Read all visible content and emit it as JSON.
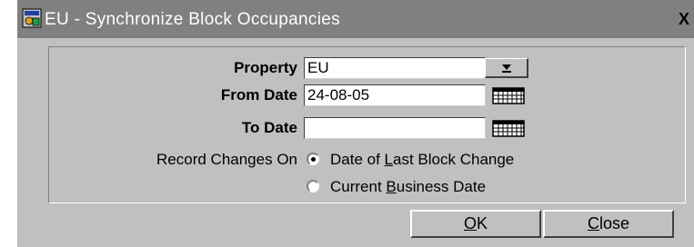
{
  "window": {
    "title": "EU - Synchronize Block Occupancies",
    "close_symbol": "X"
  },
  "form": {
    "property_label": "Property",
    "property_value": "EU",
    "from_date_label": "From Date",
    "from_date_value": "24-08-05",
    "to_date_label": "To Date",
    "to_date_value": "",
    "record_changes_label": "Record Changes On",
    "options": [
      {
        "pre": "Date of ",
        "mnemonic": "L",
        "post": "ast Block Change",
        "selected": true
      },
      {
        "pre": "Current ",
        "mnemonic": "B",
        "post": "usiness Date",
        "selected": false
      }
    ]
  },
  "buttons": {
    "ok": {
      "mnemonic": "O",
      "rest": "K"
    },
    "close": {
      "mnemonic": "C",
      "rest": "lose"
    }
  },
  "icons": {
    "app": "window-app-icon",
    "dropdown": "arrow-down-icon",
    "calendar": "calendar-icon"
  }
}
